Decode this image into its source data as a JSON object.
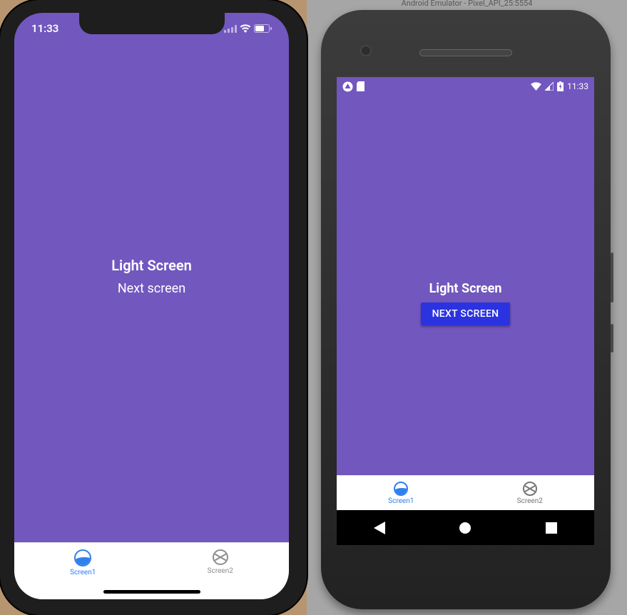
{
  "emulator_title": "Android Emulator - Pixel_API_25:5554",
  "ios": {
    "status_time": "11:33",
    "screen_title": "Light Screen",
    "next_label": "Next screen",
    "tabs": [
      {
        "label": "Screen1",
        "active": true
      },
      {
        "label": "Screen2",
        "active": false
      }
    ]
  },
  "android": {
    "status_time": "11:33",
    "screen_title": "Light Screen",
    "next_label": "NEXT SCREEN",
    "tabs": [
      {
        "label": "Screen1",
        "active": true
      },
      {
        "label": "Screen2",
        "active": false
      }
    ]
  },
  "colors": {
    "primary": "#7257be",
    "accent_ios": "#2f80ed",
    "accent_and_btn": "#2b33e0"
  }
}
